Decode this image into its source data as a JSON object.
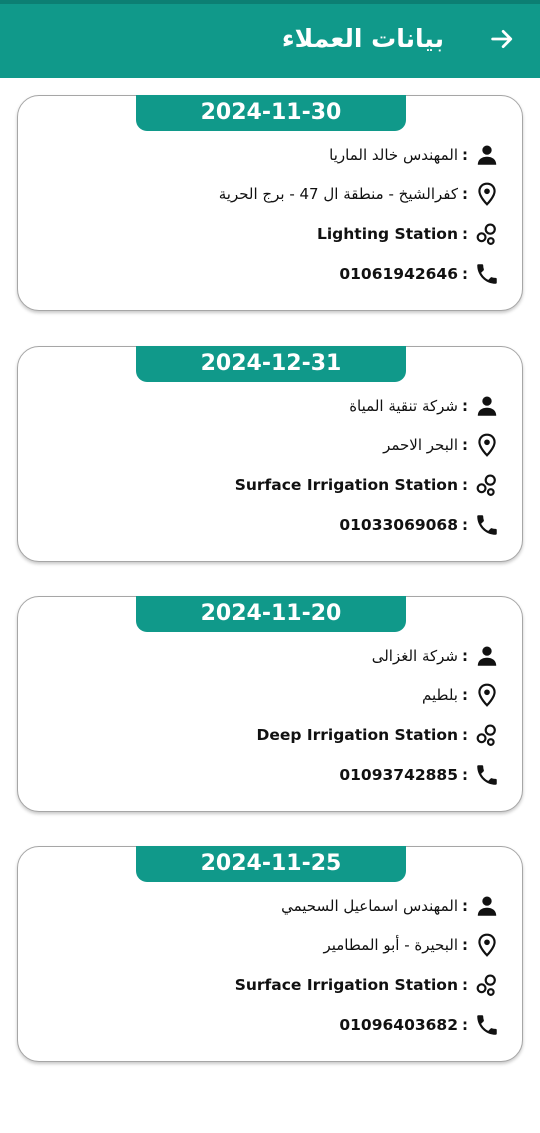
{
  "header": {
    "title": "بيانات العملاء",
    "back_icon": "arrow-right-icon"
  },
  "colors": {
    "primary": "#10998a",
    "status_bar": "#0c7f73",
    "card_border": "#a6a6a6",
    "text": "#111111"
  },
  "icons": {
    "person": "person-icon",
    "location": "location-pin-icon",
    "station": "station-icon",
    "phone": "phone-icon"
  },
  "customers": [
    {
      "date": "2024-11-30",
      "name": "المهندس خالد الماريا",
      "address": "كفرالشيخ - منطقة ال 47 - برج الحرية",
      "station": "Lighting Station",
      "phone": "01061942646"
    },
    {
      "date": "2024-12-31",
      "name": "شركة تنقية المياة",
      "address": "البحر الاحمر",
      "station": "Surface Irrigation Station",
      "phone": "01033069068"
    },
    {
      "date": "2024-11-20",
      "name": "شركة الغزالى",
      "address": "بلطيم",
      "station": "Deep Irrigation Station",
      "phone": "01093742885"
    },
    {
      "date": "2024-11-25",
      "name": "المهندس اسماعيل السحيمي",
      "address": "البحيرة - أبو المطامير",
      "station": "Surface Irrigation Station",
      "phone": "01096403682"
    }
  ]
}
